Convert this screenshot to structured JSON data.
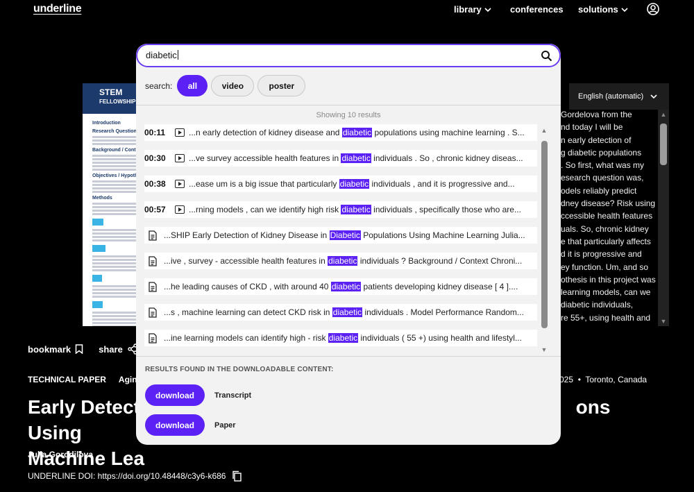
{
  "nav": {
    "logo": "underline",
    "library": "library",
    "conferences": "conferences",
    "solutions": "solutions"
  },
  "poster": {
    "title_line1": "STEM",
    "title_line2": "FELLOWSHIP",
    "sections": [
      "Introduction",
      "Research Question",
      "Background / Cont",
      "Objectives / Hypoth",
      "Methods"
    ]
  },
  "language": "English (automatic)",
  "transcript_lines": [
    "Gordelova from the",
    "nd today I will be",
    "n early detection of",
    "g diabetic populations",
    ". So first, what was my",
    "esearch question was,",
    "odels reliably predict",
    "dney disease? Risk using",
    "ccessible health features",
    "uals. So, chronic kidney",
    "e that particularly affects",
    "d it is progressive and",
    "ey function. Um, and so",
    "othesis in this project was",
    "learning models, can we",
    "diabetic individuals,",
    "re 55+, using health and"
  ],
  "actions": {
    "bookmark": "bookmark",
    "share": "share"
  },
  "meta": {
    "type": "TECHNICAL PAPER",
    "topic": "Aging",
    "date_place_prefix": "025",
    "place": "Toronto, Canada"
  },
  "title": "Early Detection of Kidney Disease in Diabetic Populations Using Machine Learning",
  "title_visible_line1_left": "Early Detecti",
  "title_visible_line1_right": "ons Using",
  "title_visible_line2_left": "Machine Lea",
  "author": "Julia Gorodilova",
  "doi": "UNDERLINE DOI: https://doi.org/10.48448/c3y6-k686",
  "search": {
    "query": "diabetic",
    "filter_label": "search:",
    "filters": {
      "all": "all",
      "video": "video",
      "poster": "poster"
    },
    "showing": "Showing 10 results",
    "results": [
      {
        "kind": "video",
        "time": "00:11",
        "before": "...n early detection of kidney disease and ",
        "match": "diabetic",
        "after": " populations using machine learning . S..."
      },
      {
        "kind": "video",
        "time": "00:30",
        "before": "...ve survey accessible health features in ",
        "match": "diabetic",
        "after": " individuals . So , chronic kidney diseas..."
      },
      {
        "kind": "video",
        "time": "00:38",
        "before": "...ease um is a big issue that particularly ",
        "match": "diabetic",
        "after": " individuals , and it is progressive and..."
      },
      {
        "kind": "video",
        "time": "00:57",
        "before": "...rning models , can we identify high risk ",
        "match": "diabetic",
        "after": " individuals , specifically those who are..."
      },
      {
        "kind": "doc",
        "before": "...SHIP Early Detection of Kidney Disease in ",
        "match": "Diabetic",
        "after": " Populations Using Machine Learning Julia..."
      },
      {
        "kind": "doc",
        "before": "...ive , survey - accessible health features in ",
        "match": "diabetic",
        "after": " individuals ? Background / Context Chroni..."
      },
      {
        "kind": "doc",
        "before": "...he leading causes of CKD , with around 40 ",
        "match": "diabetic",
        "after": " patients developing kidney disease [ 4 ]...."
      },
      {
        "kind": "doc",
        "before": "...s , machine learning can detect CKD risk in ",
        "match": "diabetic",
        "after": " individuals . Model Performance Random..."
      },
      {
        "kind": "doc",
        "before": "...ine learning models can identify high - risk ",
        "match": "diabetic",
        "after": " individuals ( 55 +) using health and lifestyl..."
      }
    ],
    "downloads_heading": "RESULTS FOUND IN THE DOWNLOADABLE CONTENT:",
    "downloads": [
      {
        "button": "download",
        "label": "Transcript"
      },
      {
        "button": "download",
        "label": "Paper"
      }
    ]
  }
}
